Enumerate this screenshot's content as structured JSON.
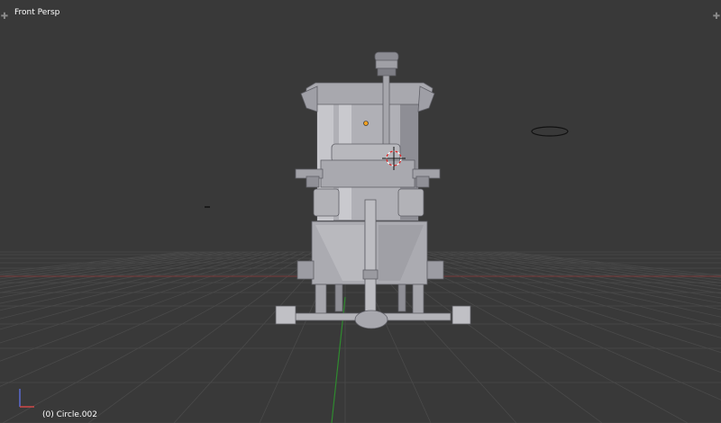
{
  "viewport": {
    "view_name": "Front Persp",
    "object_info": "(0) Circle.002",
    "background_color": "#393939"
  },
  "icons": {
    "top_left": "plus-icon",
    "top_right": "plus-icon",
    "axis_gizmo": "axis-gizmo-icon",
    "camera_object": "camera-outline-icon",
    "lamp_object": "lamp-circle-icon",
    "cursor_3d": "3d-cursor-icon"
  },
  "colors": {
    "grid_line": "#4a4a4a",
    "x_axis": "#7a3a3a",
    "y_axis": "#2f8a2f",
    "model_light": "#b4b4b9",
    "model_mid": "#9c9ca3",
    "model_dark": "#7f7f86",
    "edge": "#5f5f66"
  }
}
